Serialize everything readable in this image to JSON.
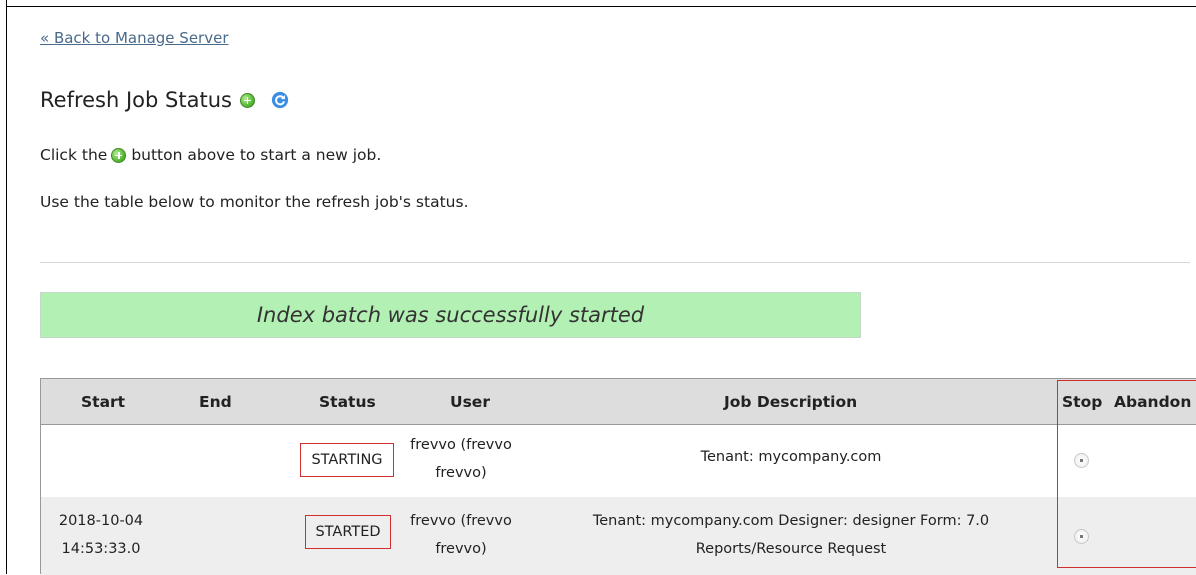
{
  "back_link": "« Back to Manage Server",
  "page_title": "Refresh Job Status",
  "instructions": {
    "line1_before": "Click the",
    "line1_after": "button above to start a new job.",
    "line2": "Use the table below to monitor the refresh job's status."
  },
  "banner": "Index batch was successfully started",
  "table": {
    "headers": {
      "start": "Start",
      "end": "End",
      "status": "Status",
      "user": "User",
      "description": "Job Description",
      "stop": "Stop",
      "abandon": "Abandon"
    },
    "rows": [
      {
        "start_date": "",
        "start_time": "",
        "end": "",
        "status": "STARTING",
        "user_line1": "frevvo (frevvo",
        "user_line2": "frevvo)",
        "description_line1": "Tenant: mycompany.com",
        "description_line2": ""
      },
      {
        "start_date": "2018-10-04",
        "start_time": "14:53:33.0",
        "end": "",
        "status": "STARTED",
        "user_line1": "frevvo (frevvo",
        "user_line2": "frevvo)",
        "description_line1": "Tenant: mycompany.com Designer: designer Form: 7.0",
        "description_line2": "Reports/Resource Request"
      }
    ]
  },
  "icons": {
    "add": "plus-circle-icon",
    "refresh": "refresh-icon",
    "stop": "stop-icon"
  },
  "colors": {
    "banner_bg": "#b3f0b3",
    "header_bg": "#dddddd",
    "highlight": "#d03030",
    "link": "#4a6a8a"
  }
}
